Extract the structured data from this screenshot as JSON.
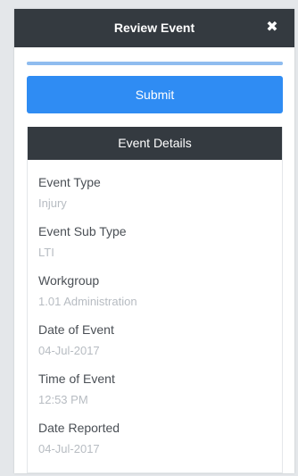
{
  "modal": {
    "title": "Review Event",
    "close_glyph": "✖",
    "close_icon": "close-icon",
    "progress_fraction": 1.0,
    "submit_label": "Submit"
  },
  "details": {
    "header": "Event Details",
    "fields": [
      {
        "label": "Event Type",
        "value": "Injury"
      },
      {
        "label": "Event Sub Type",
        "value": "LTI"
      },
      {
        "label": "Workgroup",
        "value": "1.01 Administration"
      },
      {
        "label": "Date of Event",
        "value": "04-Jul-2017"
      },
      {
        "label": "Time of Event",
        "value": "12:53 PM"
      },
      {
        "label": "Date Reported",
        "value": "04-Jul-2017"
      }
    ]
  },
  "colors": {
    "header_bg": "#343a40",
    "accent": "#2f8cf3",
    "progress": "#8fbcef",
    "label_text": "#4a4f55",
    "value_text": "#b7bcc2"
  }
}
